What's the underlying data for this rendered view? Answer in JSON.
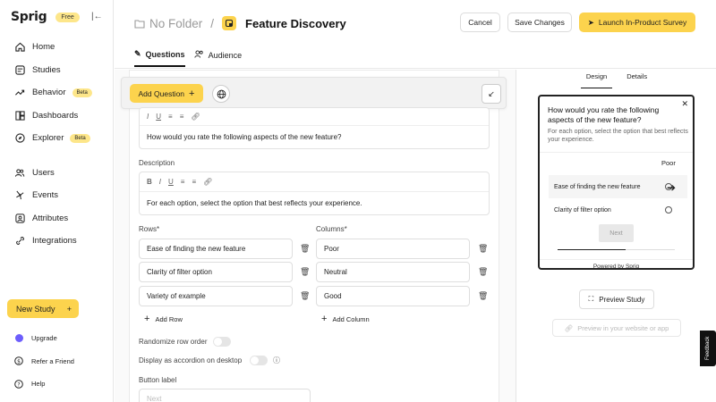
{
  "brand": {
    "logo": "Sprig",
    "plan_badge": "Free"
  },
  "sidebar": {
    "items": [
      {
        "label": "Home",
        "icon": "home-icon"
      },
      {
        "label": "Studies",
        "icon": "studies-icon"
      },
      {
        "label": "Behavior",
        "icon": "trend-icon",
        "badge": "Beta"
      },
      {
        "label": "Dashboards",
        "icon": "dashboard-icon"
      },
      {
        "label": "Explorer",
        "icon": "compass-icon",
        "badge": "Beta"
      },
      {
        "label": "Users",
        "icon": "users-icon"
      },
      {
        "label": "Events",
        "icon": "events-icon"
      },
      {
        "label": "Attributes",
        "icon": "attributes-icon"
      },
      {
        "label": "Integrations",
        "icon": "integrations-icon"
      }
    ],
    "new_study": "New Study",
    "footer": [
      {
        "label": "Upgrade"
      },
      {
        "label": "Refer a Friend"
      },
      {
        "label": "Help"
      }
    ]
  },
  "header": {
    "folder": "No Folder",
    "separator": "/",
    "study_title": "Feature Discovery",
    "cancel": "Cancel",
    "save": "Save Changes",
    "launch": "Launch In-Product Survey",
    "tabs": [
      {
        "label": "Questions",
        "active": true
      },
      {
        "label": "Audience",
        "active": false
      }
    ]
  },
  "editor": {
    "add_question": "Add Question",
    "question_text": "How would you rate the following aspects of the new feature?",
    "description_label": "Description",
    "description_text": "For each option, select the option that best reflects your experience.",
    "rows_label": "Rows*",
    "columns_label": "Columns*",
    "rows": [
      "Ease of finding the new feature",
      "Clarity of filter option",
      "Variety of example"
    ],
    "columns": [
      "Poor",
      "Neutral",
      "Good"
    ],
    "add_row": "Add Row",
    "add_column": "Add Column",
    "randomize_label": "Randomize row order",
    "accordion_label": "Display as accordion on desktop",
    "button_label": "Button label",
    "button_placeholder": "Next"
  },
  "preview": {
    "tabs": [
      {
        "label": "Design",
        "active": true
      },
      {
        "label": "Details",
        "active": false
      }
    ],
    "question": "How would you rate the following aspects of the new feature?",
    "description": "For each option, select the option that best reflects your experience.",
    "column": "Poor",
    "rows": [
      "Ease of finding the new feature",
      "Clarity of filter option"
    ],
    "next": "Next",
    "powered_by": "Powered by Sprig",
    "preview_study": "Preview Study",
    "preview_web": "Preview in your website or app"
  },
  "feedback_tab": "Feedback",
  "colors": {
    "accent": "#fcd34d",
    "badge": "#fde68a",
    "upgrade": "#6d5efc"
  }
}
